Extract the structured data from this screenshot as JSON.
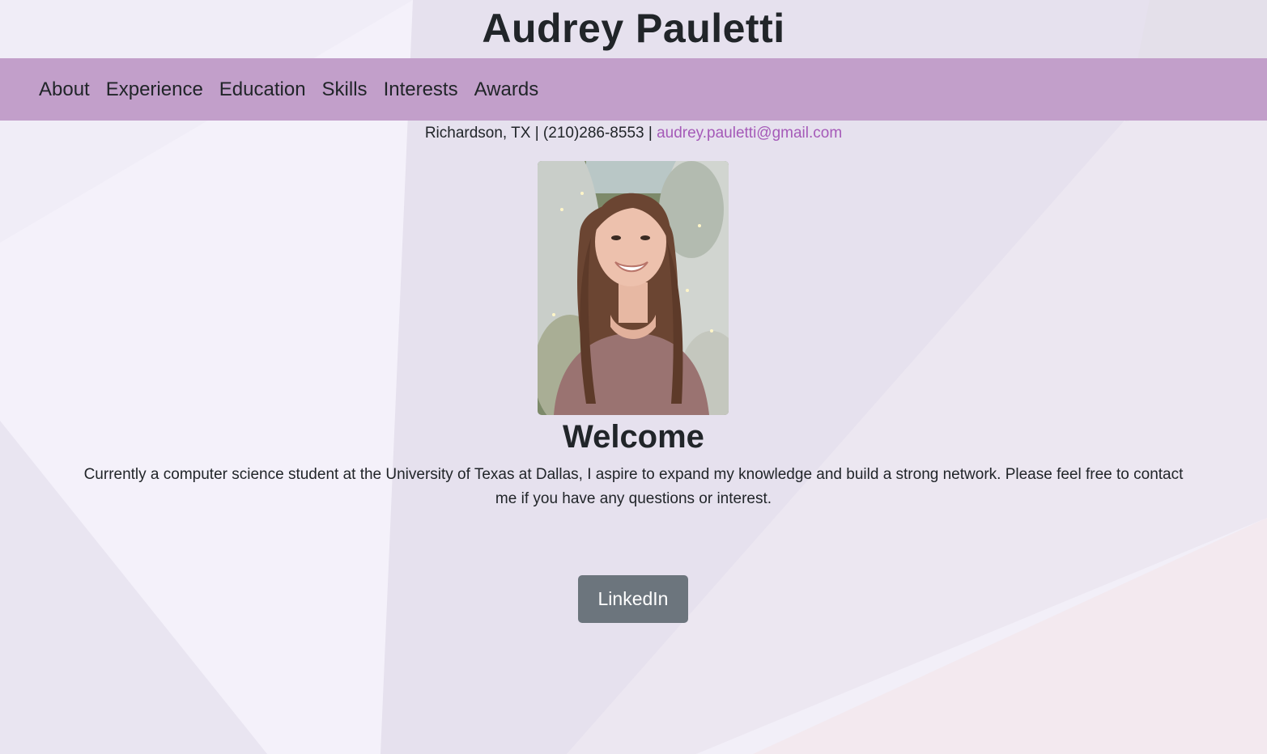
{
  "header": {
    "title": "Audrey Pauletti"
  },
  "nav": {
    "items": [
      {
        "label": "About"
      },
      {
        "label": "Experience"
      },
      {
        "label": "Education"
      },
      {
        "label": "Skills"
      },
      {
        "label": "Interests"
      },
      {
        "label": "Awards"
      }
    ]
  },
  "contact": {
    "location": "Richardson, TX",
    "separator": "|",
    "phone": "(210)286-8553",
    "email": "audrey.pauletti@gmail.com"
  },
  "profile": {
    "photo_icon": "portrait-photo"
  },
  "main": {
    "heading": "Welcome",
    "intro": "Currently a computer science student at the University of Texas at Dallas, I aspire to expand my knowledge and build a strong network. Please feel free to contact me if you have any questions or interest.",
    "linkedin_label": "LinkedIn"
  },
  "colors": {
    "nav_background": "#c29fca",
    "link": "#a55ab8",
    "button": "#6c757d",
    "page_background": "#f1eef7"
  }
}
